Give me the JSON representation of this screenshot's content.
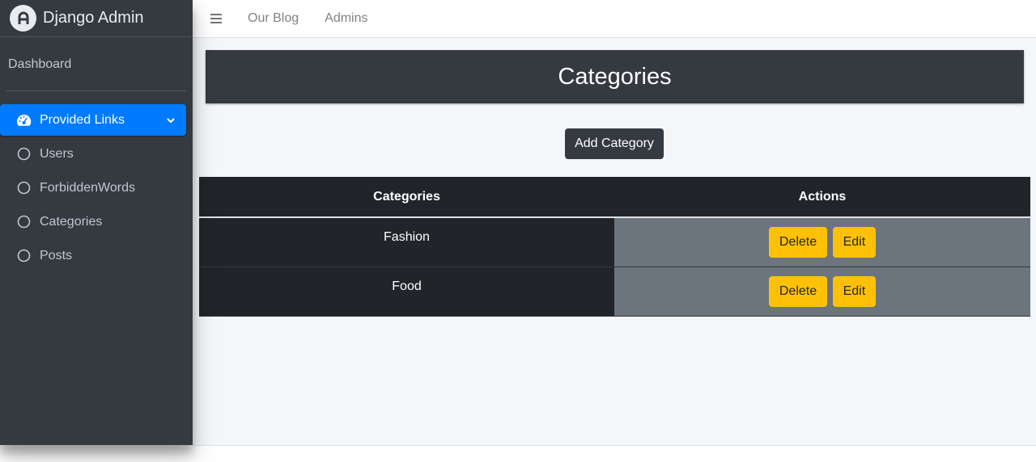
{
  "sidebar": {
    "brand": "Django Admin",
    "dashboard": "Dashboard",
    "menu": {
      "group_label": "Provided Links",
      "items": [
        {
          "label": "Users"
        },
        {
          "label": "ForbiddenWords"
        },
        {
          "label": "Categories"
        },
        {
          "label": "Posts"
        }
      ]
    }
  },
  "topbar": {
    "links": [
      "Our Blog",
      "Admins"
    ]
  },
  "main": {
    "title": "Categories",
    "add_button": "Add Category",
    "table": {
      "columns": [
        "Categories",
        "Actions"
      ],
      "rows": [
        {
          "name": "Fashion",
          "delete": "Delete",
          "edit": "Edit"
        },
        {
          "name": "Food",
          "delete": "Delete",
          "edit": "Edit"
        }
      ]
    }
  },
  "colors": {
    "sidebar_bg": "#343a40",
    "active_blue": "#007bff",
    "table_dark": "#212529",
    "action_bg": "#6c757d",
    "warning": "#ffc107"
  },
  "icons": [
    "brand-logo-icon",
    "tachometer-icon",
    "chevron-down-icon",
    "circle-outline-icon",
    "hamburger-icon"
  ]
}
